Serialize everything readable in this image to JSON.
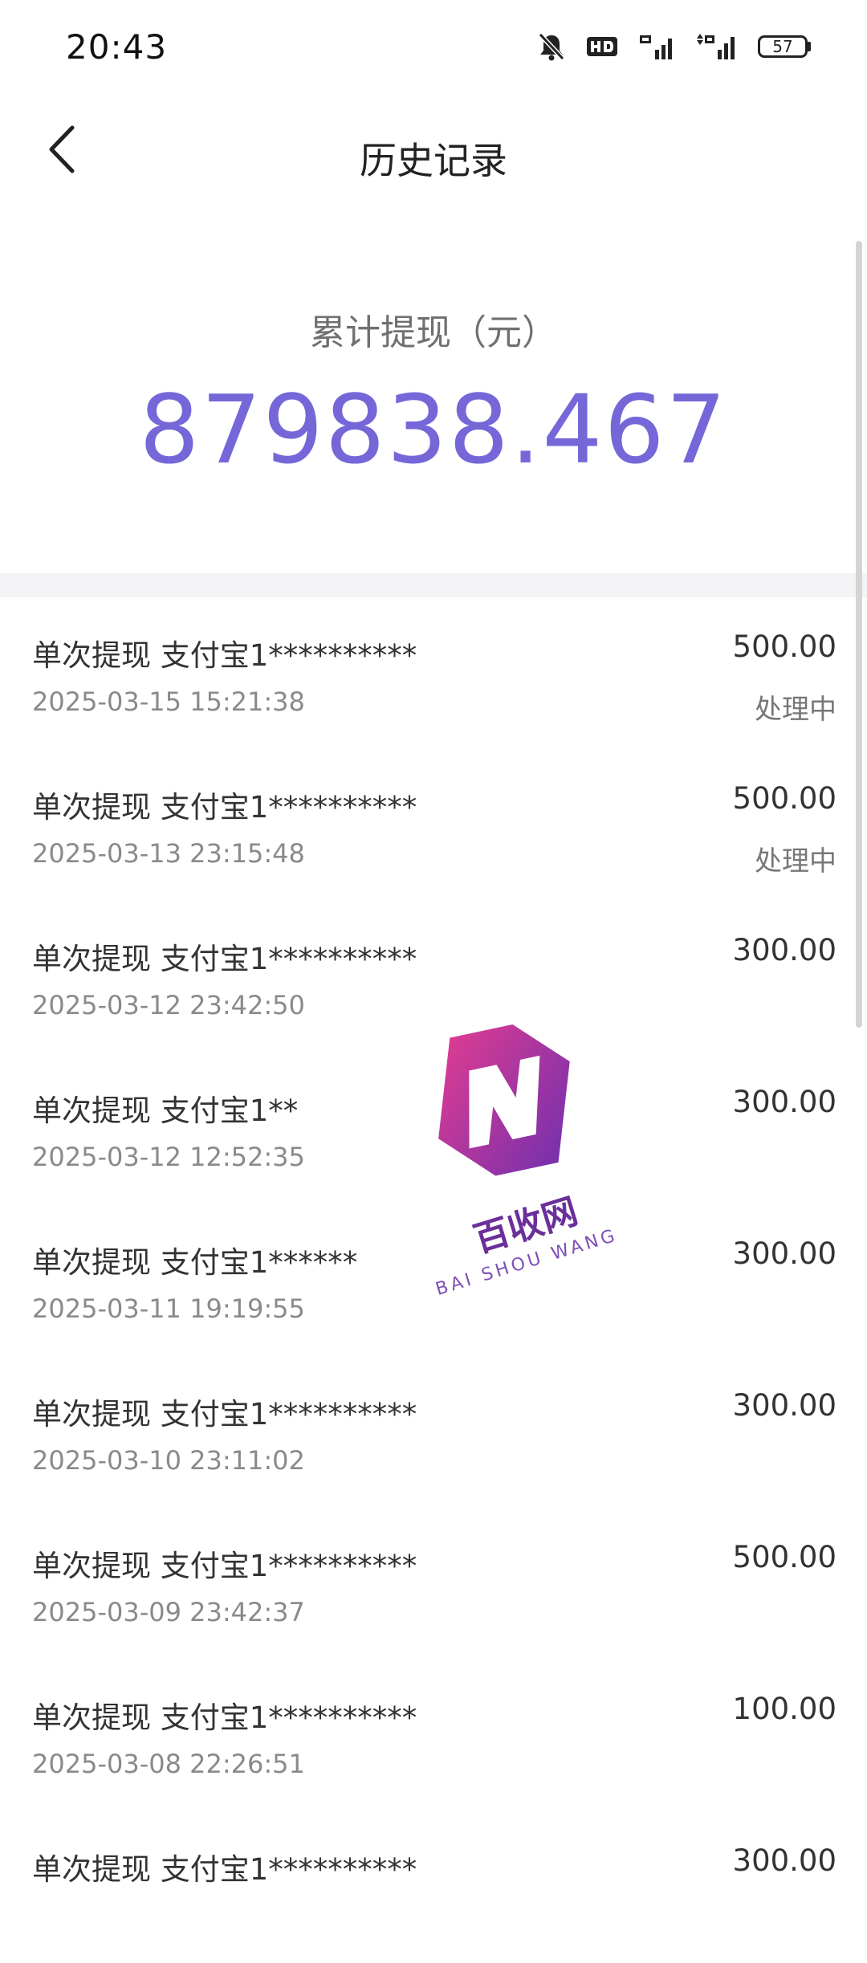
{
  "status_bar": {
    "time": "20:43",
    "icons": [
      "bell-muted-icon",
      "hd-icon",
      "signal-5g-icon",
      "signal-5g-icon"
    ],
    "battery": "57"
  },
  "header": {
    "title": "历史记录"
  },
  "summary": {
    "label": "累计提现（元）",
    "amount": "879838.467",
    "accent_color": "#7567d8"
  },
  "records": [
    {
      "title": "单次提现 支付宝1**********",
      "time": "2025-03-15 15:21:38",
      "amount": "500.00",
      "status": "处理中"
    },
    {
      "title": "单次提现 支付宝1**********",
      "time": "2025-03-13 23:15:48",
      "amount": "500.00",
      "status": "处理中"
    },
    {
      "title": "单次提现 支付宝1**********",
      "time": "2025-03-12 23:42:50",
      "amount": "300.00",
      "status": ""
    },
    {
      "title": "单次提现 支付宝1**",
      "time": "2025-03-12 12:52:35",
      "amount": "300.00",
      "status": ""
    },
    {
      "title": "单次提现 支付宝1******",
      "time": "2025-03-11 19:19:55",
      "amount": "300.00",
      "status": ""
    },
    {
      "title": "单次提现 支付宝1**********",
      "time": "2025-03-10 23:11:02",
      "amount": "300.00",
      "status": ""
    },
    {
      "title": "单次提现 支付宝1**********",
      "time": "2025-03-09 23:42:37",
      "amount": "500.00",
      "status": ""
    },
    {
      "title": "单次提现 支付宝1**********",
      "time": "2025-03-08 22:26:51",
      "amount": "100.00",
      "status": ""
    },
    {
      "title": "单次提现 支付宝1**********",
      "time": "",
      "amount": "300.00",
      "status": ""
    }
  ],
  "watermark": {
    "name_cn": "百收网",
    "name_en": "BAI SHOU WANG"
  }
}
